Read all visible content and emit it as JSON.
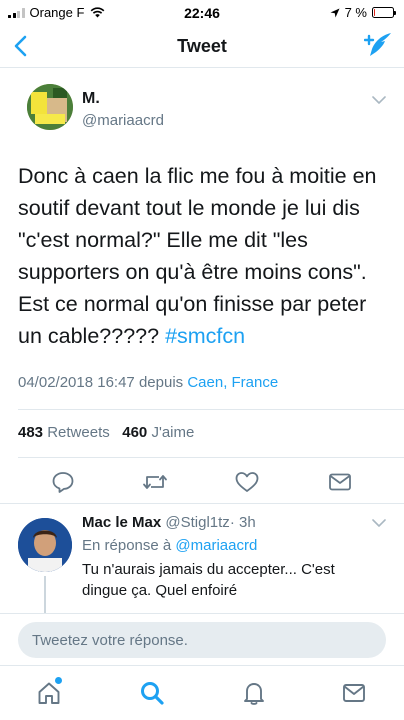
{
  "status_bar": {
    "carrier": "Orange F",
    "time": "22:46",
    "battery_percent": "7 %",
    "battery_level": 0.07,
    "signal_bars_active": 2,
    "battery_color": "#e0261b"
  },
  "nav": {
    "title": "Tweet",
    "back_icon": "chevron-left-icon",
    "compose_icon": "compose-tweet-icon"
  },
  "tweet": {
    "author_name": "M.",
    "author_handle": "@mariaacrd",
    "text": "Donc à caen la flic me fou à moitie en soutif devant tout le monde je lui dis \"c'est normal?\" Elle me dit \"les supporters on qu'à être moins cons\". Est ce normal qu'on finisse par peter un cable?????",
    "hashtag": "#smcfcn",
    "timestamp": "04/02/2018 16:47",
    "via": "depuis",
    "place": "Caen, France",
    "retweets_count": "483",
    "retweets_label": "Retweets",
    "likes_count": "460",
    "likes_label": "J'aime"
  },
  "reply": {
    "name": "Mac le Max",
    "handle": "@Stigl1tz",
    "separator": "·",
    "age": "3h",
    "in_reply_to_label": "En réponse à",
    "in_reply_to_handle": "@mariaacrd",
    "text": "Tu n'aurais jamais du accepter... C'est dingue ça. Quel enfoiré"
  },
  "reply_bar": {
    "placeholder": "Tweetez votre réponse."
  },
  "tab_bar": {
    "items": [
      "home-icon",
      "search-icon",
      "notifications-icon",
      "messages-icon"
    ],
    "active": "search-icon"
  },
  "colors": {
    "accent": "#1da1f2",
    "secondary_text": "#657786",
    "icon_gray": "#657786"
  }
}
